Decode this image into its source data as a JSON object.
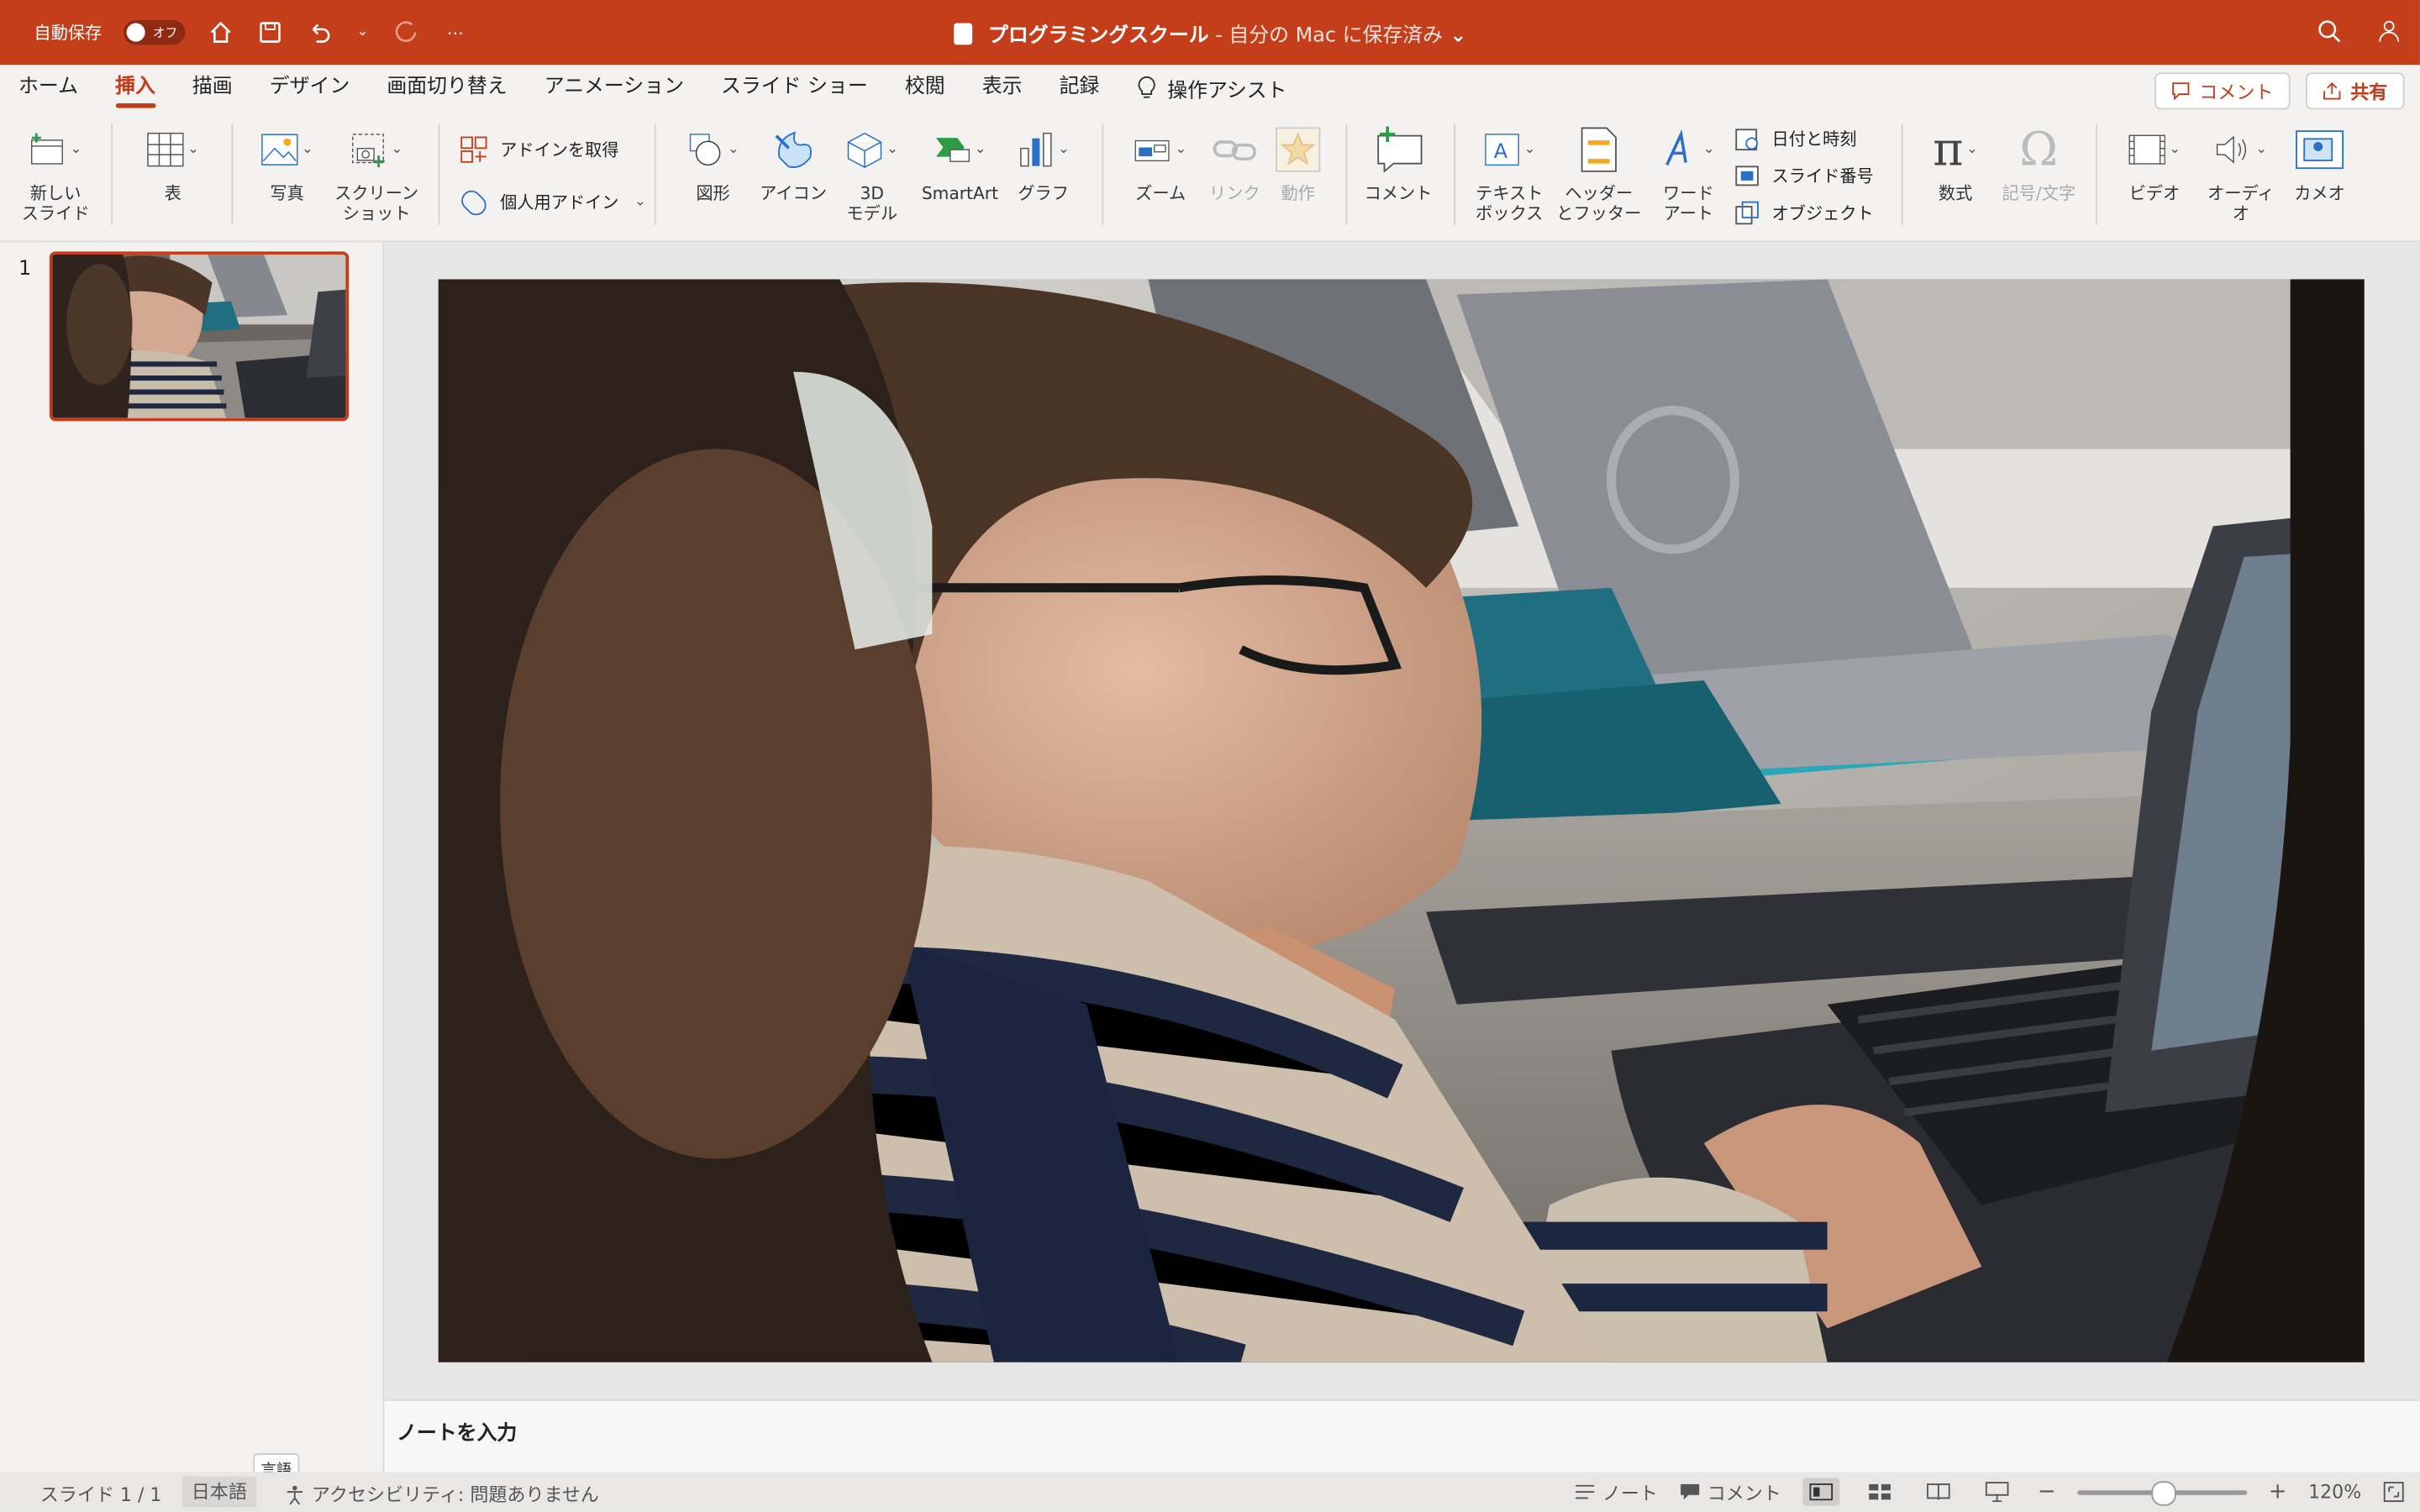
{
  "titlebar": {
    "autosave_label": "自動保存",
    "autosave_state": "オフ",
    "doc_title": "プログラミングスクール",
    "doc_status": " - 自分の Mac に保存済み",
    "chevron": "⌄"
  },
  "tabs": [
    {
      "label": "ホーム"
    },
    {
      "label": "挿入",
      "active": true
    },
    {
      "label": "描画"
    },
    {
      "label": "デザイン"
    },
    {
      "label": "画面切り替え"
    },
    {
      "label": "アニメーション"
    },
    {
      "label": "スライド ショー"
    },
    {
      "label": "校閲"
    },
    {
      "label": "表示"
    },
    {
      "label": "記録"
    }
  ],
  "tell_me": "操作アシスト",
  "top_buttons": {
    "comment": "コメント",
    "share": "共有"
  },
  "ribbon": {
    "new_slide": "新しい\nスライド",
    "table": "表",
    "photo": "写真",
    "screenshot": "スクリーン\nショット",
    "get_addins": "アドインを取得",
    "my_addins": "個人用アドイン",
    "shapes": "図形",
    "icons": "アイコン",
    "model3d": "3D\nモデル",
    "smartart": "SmartArt",
    "chart": "グラフ",
    "zoom": "ズーム",
    "link": "リンク",
    "action": "動作",
    "comment": "コメント",
    "textbox": "テキスト\nボックス",
    "header_footer": "ヘッダー\nとフッター",
    "wordart": "ワード\nアート",
    "date_time": "日付と時刻",
    "slide_number": "スライド番号",
    "object": "オブジェクト",
    "equation": "数式",
    "symbol": "記号/文字",
    "video": "ビデオ",
    "audio": "オーディオ",
    "cameo": "カメオ"
  },
  "sidebar": {
    "slide_number": "1"
  },
  "notes_placeholder": "ノートを入力",
  "status": {
    "slide_count": "スライド 1 / 1",
    "language": "日本語",
    "tooltip": "言語",
    "accessibility": "アクセシビリティ: 問題ありません",
    "notes": "ノート",
    "comments": "コメント",
    "zoom": "120%",
    "zoom_fraction": 0.5
  },
  "colors": {
    "accent": "#c43e1c"
  }
}
